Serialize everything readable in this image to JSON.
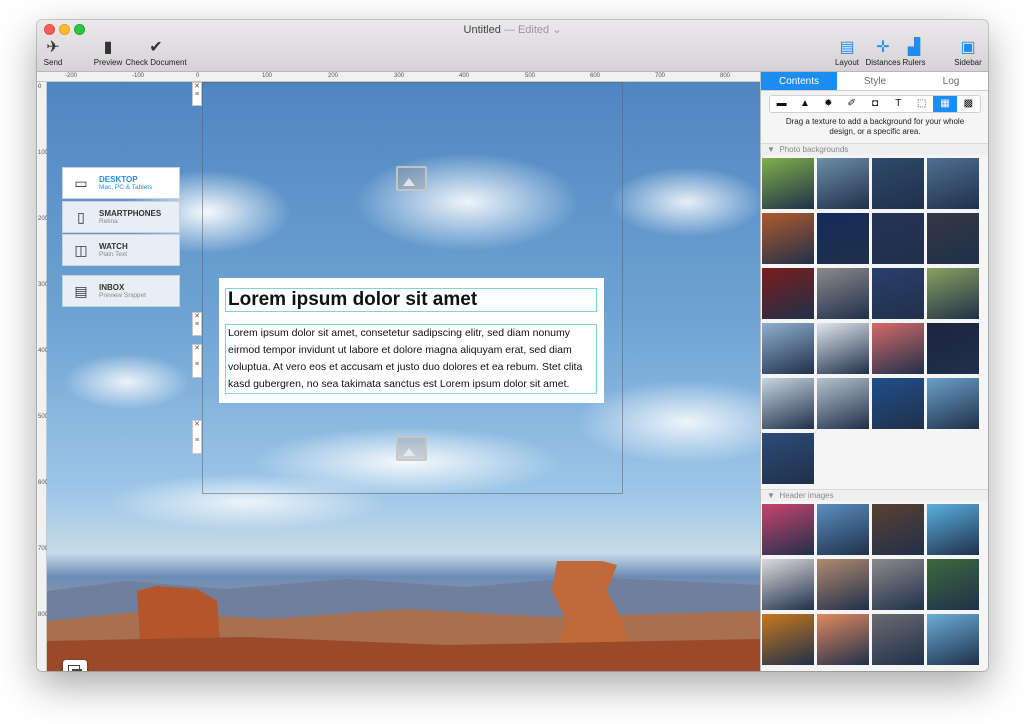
{
  "window": {
    "title": "Untitled",
    "title_sep": " — ",
    "edited": "Edited",
    "edited_chevron": "⌄"
  },
  "toolbar": {
    "left": [
      {
        "label": "Send",
        "icon": "send-icon",
        "glyph": "✈"
      },
      {
        "label": "Preview",
        "icon": "phone-preview-icon",
        "glyph": "▮"
      },
      {
        "label": "Check Document",
        "icon": "checkmark-icon",
        "glyph": "✔"
      }
    ],
    "right": [
      {
        "label": "Layout",
        "icon": "layout-icon",
        "glyph": "▤"
      },
      {
        "label": "Distances",
        "icon": "distances-icon",
        "glyph": "✛"
      },
      {
        "label": "Rulers",
        "icon": "rulers-icon",
        "glyph": "▟"
      },
      {
        "label": "Sidebar",
        "icon": "sidebar-icon",
        "glyph": "▣"
      }
    ]
  },
  "rulers": {
    "horizontal": [
      "-200",
      "-100",
      "0",
      "100",
      "200",
      "300",
      "400",
      "500",
      "600",
      "700",
      "800"
    ],
    "vertical": [
      "0",
      "100",
      "200",
      "300",
      "400",
      "500",
      "600",
      "700",
      "800"
    ]
  },
  "devices": [
    {
      "name": "DESKTOP",
      "sub": "Mac, PC & Tablets",
      "icon": "laptop-icon",
      "glyph": "💻",
      "active": true
    },
    {
      "name": "SMARTPHONES",
      "sub": "Retina",
      "icon": "smartphone-icon",
      "glyph": "▯",
      "active": false
    },
    {
      "name": "WATCH",
      "sub": "Plain Text",
      "icon": "watch-icon",
      "glyph": "⌚",
      "active": false
    },
    {
      "name": "INBOX",
      "sub": "Preview Snippet",
      "icon": "inbox-icon",
      "glyph": "▤",
      "active": false
    }
  ],
  "content": {
    "headline": "Lorem ipsum dolor sit amet",
    "body": "Lorem ipsum dolor sit amet, consetetur sadipscing elitr, sed diam nonumy eirmod tempor invidunt ut labore et dolore magna aliquyam erat, sed diam voluptua. At vero eos et accusam et justo duo dolores et ea rebum. Stet clita kasd gubergren, no sea takimata sanctus est Lorem ipsum dolor sit amet."
  },
  "sidebar": {
    "tabs": [
      {
        "label": "Contents",
        "active": true
      },
      {
        "label": "Style",
        "active": false
      },
      {
        "label": "Log",
        "active": false
      }
    ],
    "tools": [
      {
        "icon": "block-icon",
        "glyph": "▬"
      },
      {
        "icon": "triangle-icon",
        "glyph": "▲"
      },
      {
        "icon": "burst-icon",
        "glyph": "✹"
      },
      {
        "icon": "eyedropper-icon",
        "glyph": "✐"
      },
      {
        "icon": "button-icon",
        "glyph": "◘"
      },
      {
        "icon": "text-icon",
        "glyph": "T"
      },
      {
        "icon": "selection-icon",
        "glyph": "⬚"
      },
      {
        "icon": "texture-icon",
        "glyph": "▦",
        "active": true
      },
      {
        "icon": "image-icon",
        "glyph": "▩"
      }
    ],
    "help": "Drag a texture to add a background for your whole design, or a specific area.",
    "photo_section": "Photo backgrounds",
    "header_section": "Header images",
    "photo_thumbs": [
      "#7fb04a",
      "#6c8ea8",
      "#2e4a6c",
      "#4f6f93",
      "#b05a2c",
      "#142a5a",
      "#253457",
      "#333844",
      "#7a1c1c",
      "#8a8a8a",
      "#2a3f6c",
      "#8aa060",
      "#8fb0d0",
      "#dfe6ec",
      "#d36a6a",
      "#1d2440",
      "#c7d6e0",
      "#b5c2cc",
      "#1f4f8a",
      "#6aa0c8",
      "#2c4c78"
    ],
    "header_thumbs": [
      "#c8446e",
      "#5a8fc0",
      "#5a4030",
      "#5ab0e0",
      "#dcdcdc",
      "#b08a70",
      "#8a8a8a",
      "#3c6a3c",
      "#c8781e",
      "#e08a60",
      "#6a6a70",
      "#6aaed8"
    ]
  }
}
